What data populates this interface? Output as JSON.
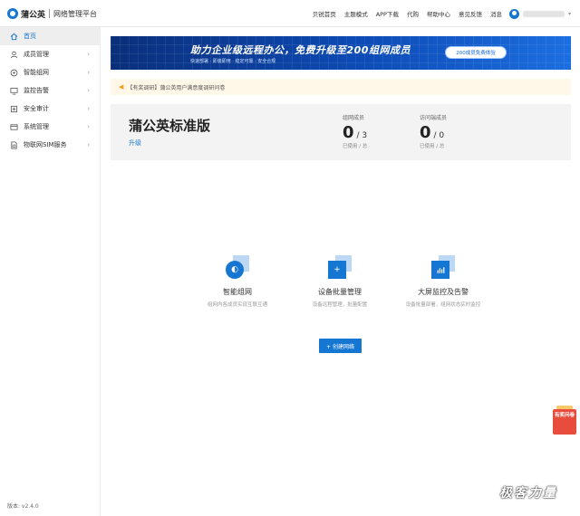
{
  "header": {
    "brand_name": "蒲公英",
    "brand_sub": "网络管理平台",
    "nav": [
      "贝锐首页",
      "主题模式",
      "APP下载",
      "代购",
      "帮助中心",
      "意见反馈",
      "消息"
    ],
    "user_icon": "user-avatar-icon",
    "caret_icon": "chevron-down-icon"
  },
  "sidebar": {
    "items": [
      {
        "label": "首页",
        "icon": "home-icon",
        "active": true
      },
      {
        "label": "成员管理",
        "icon": "user-icon"
      },
      {
        "label": "智能组网",
        "icon": "network-icon"
      },
      {
        "label": "监控告警",
        "icon": "monitor-icon"
      },
      {
        "label": "安全审计",
        "icon": "shield-icon"
      },
      {
        "label": "系统管理",
        "icon": "settings-icon"
      },
      {
        "label": "物联网SIM服务",
        "icon": "sim-icon"
      }
    ],
    "version": "版本: v2.4.0"
  },
  "banner": {
    "title": "助力企业级远程办公，免费升级至200组网成员",
    "tags": "快速部署 · 即装即用 · 稳定可靠 · 安全合规",
    "button": "200成员免费体验"
  },
  "notice": {
    "text": "【有奖调研】蒲公英用户满意度调研问卷"
  },
  "plan": {
    "name": "蒲公英标准版",
    "upgrade": "升级",
    "stats": [
      {
        "label": "组网成员",
        "used": "0",
        "total": "/ 3",
        "sub": "已使用 / 总"
      },
      {
        "label": "访问端成员",
        "used": "0",
        "total": "/ 0",
        "sub": "已使用 / 总"
      }
    ]
  },
  "features": [
    {
      "title": "智能组网",
      "desc": "组网内各成员实现互联互通",
      "icon": "network-globe-icon"
    },
    {
      "title": "设备批量管理",
      "desc": "设备远程管理，批量配置",
      "icon": "add-device-icon"
    },
    {
      "title": "大屏监控及告警",
      "desc": "设备批量部署，组网状态实时监控",
      "icon": "bar-chart-icon"
    }
  ],
  "create_button": "+ 创建网络",
  "survey_badge": "有奖问卷",
  "watermark": "极客力量",
  "colors": {
    "accent": "#1677d2",
    "notice_bg": "#fff8e8",
    "card_bg": "#f3f3f3"
  }
}
